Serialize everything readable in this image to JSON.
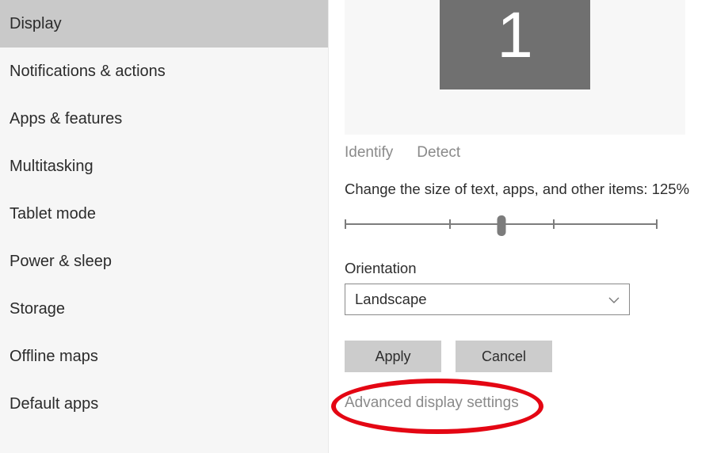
{
  "sidebar": {
    "items": [
      {
        "label": "Display",
        "selected": true
      },
      {
        "label": "Notifications & actions"
      },
      {
        "label": "Apps & features"
      },
      {
        "label": "Multitasking"
      },
      {
        "label": "Tablet mode"
      },
      {
        "label": "Power & sleep"
      },
      {
        "label": "Storage"
      },
      {
        "label": "Offline maps"
      },
      {
        "label": "Default apps"
      }
    ]
  },
  "display": {
    "monitor_number": "1",
    "identify_label": "Identify",
    "detect_label": "Detect",
    "scale_label": "Change the size of text, apps, and other items: 125%",
    "orientation_label": "Orientation",
    "orientation_value": "Landscape",
    "apply_label": "Apply",
    "cancel_label": "Cancel",
    "advanced_link": "Advanced display settings"
  },
  "colors": {
    "sidebar_bg": "#f6f6f6",
    "sidebar_selected": "#c9c9c9",
    "monitor_tile": "#707070",
    "button_bg": "#cccccc",
    "link_muted": "#8a8a8a",
    "annotation_red": "#e40613"
  }
}
